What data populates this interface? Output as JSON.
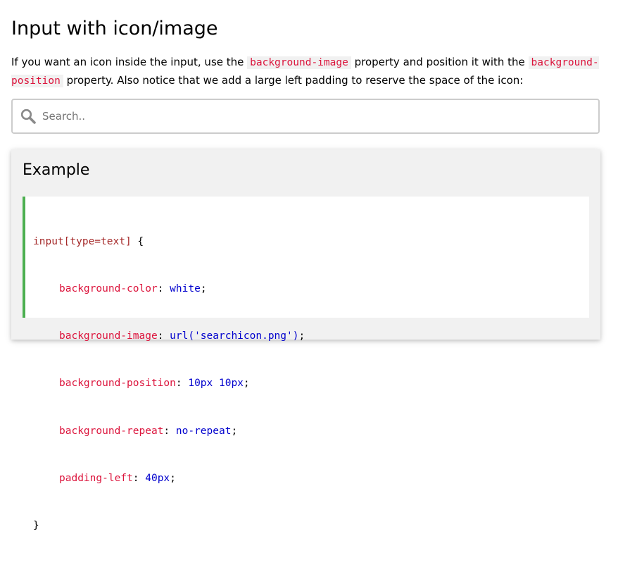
{
  "title": "Input with icon/image",
  "intro": {
    "text_1": "If you want an icon inside the input, use the ",
    "code_1": "background-image",
    "text_2": " property and position it with the ",
    "code_2": "background-position",
    "text_3": " property. Also notice that we add a large left padding to reserve the space of the icon:"
  },
  "search": {
    "placeholder": "Search..",
    "value": "",
    "icon": "search-icon"
  },
  "example": {
    "heading": "Example",
    "code": {
      "selector": "input[type=text]",
      "open_brace": " {",
      "declarations": [
        {
          "property": "background-color",
          "value": "white"
        },
        {
          "property": "background-image",
          "value": "url('searchicon.png')"
        },
        {
          "property": "background-position",
          "value": "10px 10px"
        },
        {
          "property": "background-repeat",
          "value": "no-repeat"
        },
        {
          "property": "padding-left",
          "value": "40px"
        }
      ],
      "close_brace": "}"
    }
  },
  "colors": {
    "code_accent": "#4caf50",
    "code_property": "#dc143c",
    "code_value": "#0000cd",
    "code_selector": "#a52a2a",
    "panel_bg": "#f1f1f1"
  }
}
